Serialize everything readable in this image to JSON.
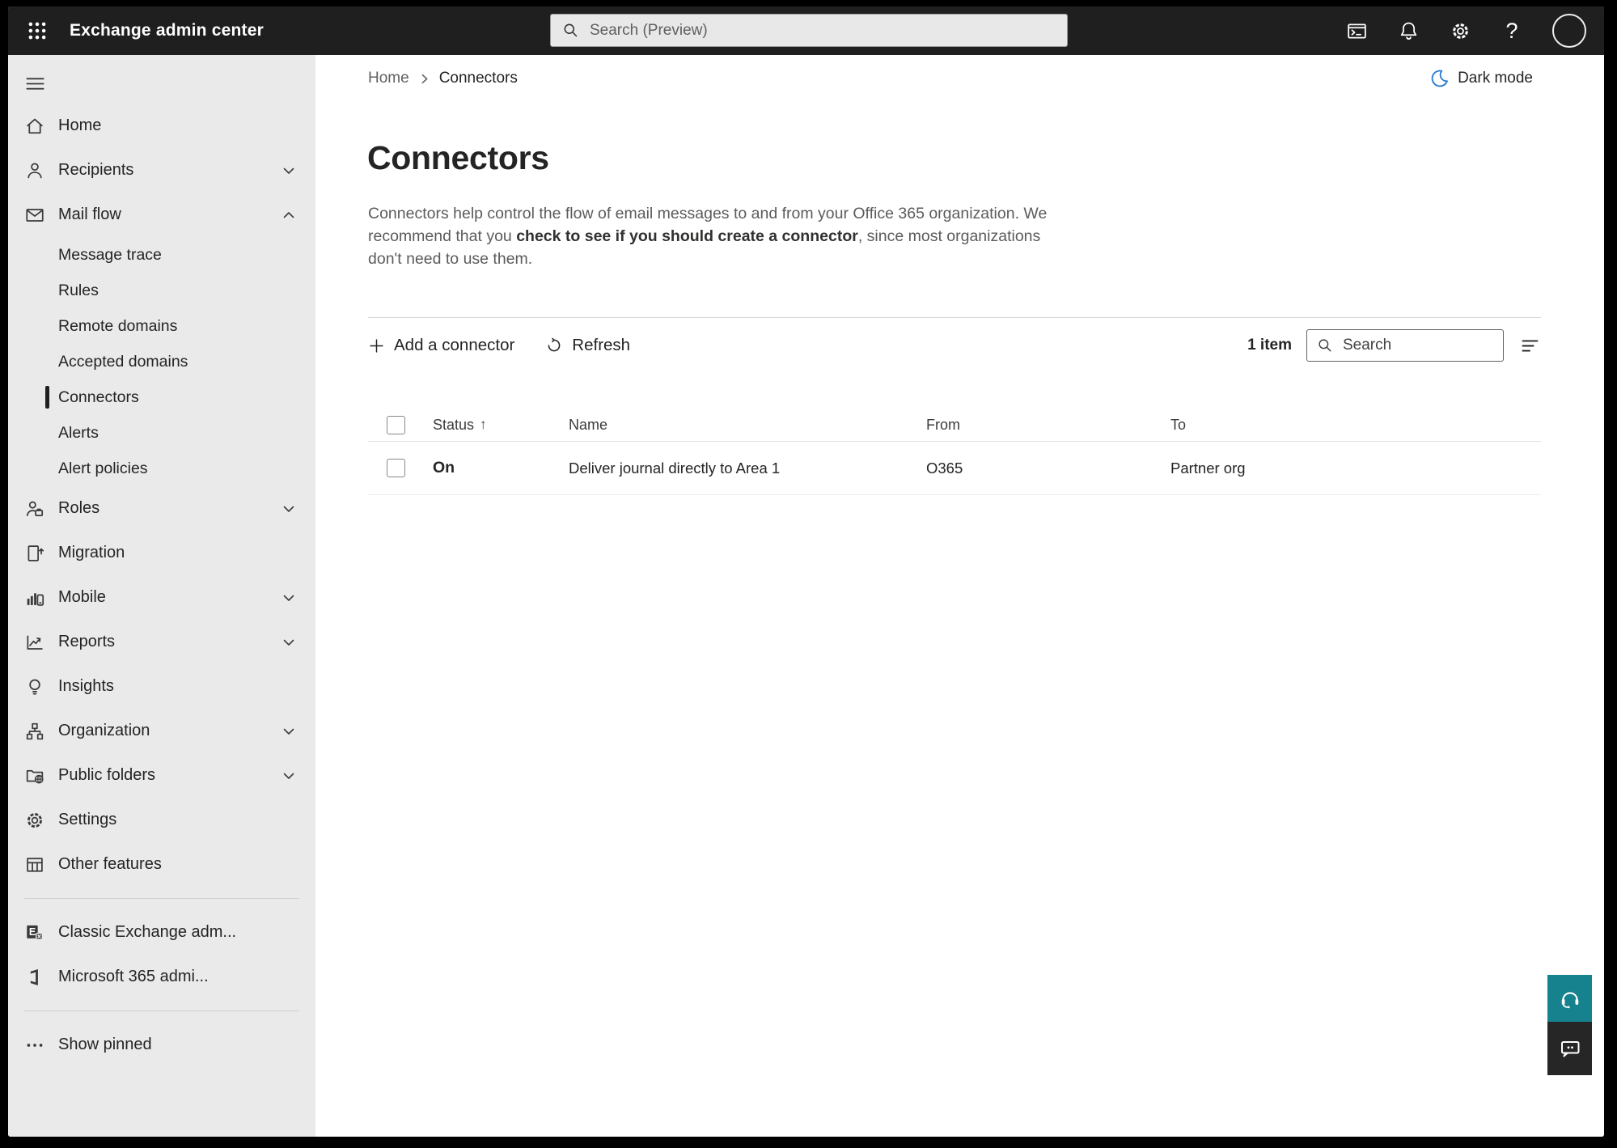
{
  "colors": {
    "header_bg": "#1f1f1f",
    "sidebar_bg": "#eaeaea",
    "selected_indicator": "#1f1f1f",
    "moon_blue": "#2b7cd3",
    "support_teal": "#15828d",
    "feedback_dark": "#262626"
  },
  "header": {
    "app_title": "Exchange admin center",
    "search_placeholder": "Search (Preview)"
  },
  "sidebar": {
    "items": [
      {
        "label": "Home"
      },
      {
        "label": "Recipients"
      },
      {
        "label": "Mail flow"
      },
      {
        "label": "Message trace"
      },
      {
        "label": "Rules"
      },
      {
        "label": "Remote domains"
      },
      {
        "label": "Accepted domains"
      },
      {
        "label": "Connectors"
      },
      {
        "label": "Alerts"
      },
      {
        "label": "Alert policies"
      },
      {
        "label": "Roles"
      },
      {
        "label": "Migration"
      },
      {
        "label": "Mobile"
      },
      {
        "label": "Reports"
      },
      {
        "label": "Insights"
      },
      {
        "label": "Organization"
      },
      {
        "label": "Public folders"
      },
      {
        "label": "Settings"
      },
      {
        "label": "Other features"
      },
      {
        "label": "Classic Exchange adm..."
      },
      {
        "label": "Microsoft 365 admi..."
      },
      {
        "label": "Show pinned"
      }
    ]
  },
  "breadcrumb": {
    "home": "Home",
    "current": "Connectors"
  },
  "dark_mode": {
    "label": "Dark mode"
  },
  "page": {
    "title": "Connectors",
    "desc_before": "Connectors help control the flow of email messages to and from your Office 365 organization. We recommend that you ",
    "desc_bold": "check to see if you should create a connector",
    "desc_after": ", since most organizations don't need to use them."
  },
  "toolbar": {
    "add_connector": "Add a connector",
    "refresh": "Refresh",
    "item_count": "1 item",
    "search_placeholder": "Search"
  },
  "table": {
    "columns": {
      "status": "Status",
      "name": "Name",
      "from": "From",
      "to": "To"
    },
    "sort_arrow": "↑",
    "rows": [
      {
        "status": "On",
        "name": "Deliver journal directly to Area 1",
        "from": "O365",
        "to": "Partner org"
      }
    ]
  }
}
